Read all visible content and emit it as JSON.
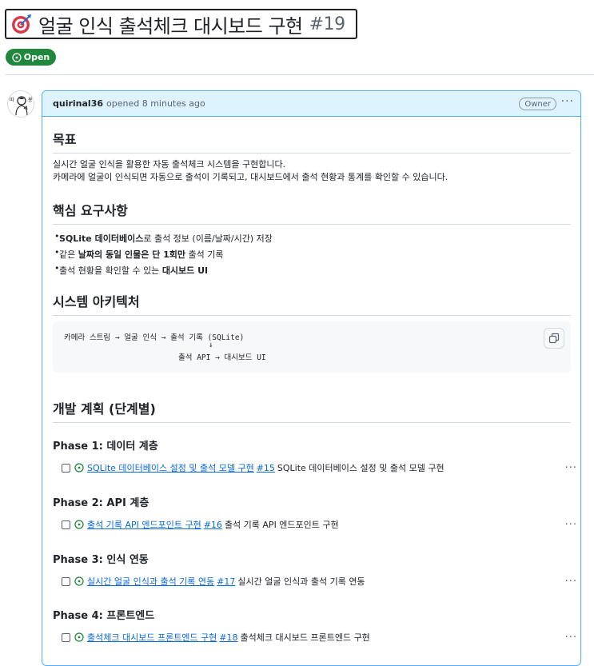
{
  "issue": {
    "title": "얼굴 인식 출석체크 대시보드 구현",
    "number": "#19",
    "status": "Open",
    "title_icon": "dart-target-icon"
  },
  "comment": {
    "author": "quirinal36",
    "meta": "opened 8 minutes ago",
    "role": "Owner",
    "avatar_label": "따봉"
  },
  "sections": {
    "goal": {
      "heading": "목표",
      "line1": "실시간 얼굴 인식을 활용한 자동 출석체크 시스템을 구현합니다.",
      "line2": "카메라에 얼굴이 인식되면 자동으로 출석이 기록되고, 대시보드에서 출석 현황과 통계를 확인할 수 있습니다."
    },
    "requirements": {
      "heading": "핵심 요구사항",
      "items": [
        {
          "bold": "SQLite 데이터베이스",
          "rest": "로 출석 정보 (이름/날짜/시간) 저장"
        },
        {
          "pre": "같은 ",
          "bold": "날짜의 동일 인물은 단 1회만",
          "rest": " 출석 기록"
        },
        {
          "pre": "출석 현황을 확인할 수 있는 ",
          "bold": "대시보드 UI",
          "rest": ""
        }
      ]
    },
    "architecture": {
      "heading": "시스템 아키텍처",
      "code_line1": "카메라 스트림 → 얼굴 인식 → 출석 기록 (SQLite)",
      "code_line2": "↓",
      "code_line3": "출석 API → 대시보드 UI"
    },
    "plan": {
      "heading": "개발 계획 (단계별)",
      "phases": [
        {
          "title": "Phase 1: 데이터 계층",
          "link": "SQLite 데이터베이스 설정 및 출석 모델 구현",
          "num": "#15",
          "desc": "SQLite 데이터베이스 설정 및 출석 모델 구현"
        },
        {
          "title": "Phase 2: API 계층",
          "link": "출석 기록 API 엔드포인트 구현",
          "num": "#16",
          "desc": "출석 기록 API 엔드포인트 구현"
        },
        {
          "title": "Phase 3: 인식 연동",
          "link": "실시간 얼굴 인식과 출석 기록 연동",
          "num": "#17",
          "desc": "실시간 얼굴 인식과 출석 기록 연동"
        },
        {
          "title": "Phase 4: 프론트엔드",
          "link": "출석체크 대시보드 프론트엔드 구현",
          "num": "#18",
          "desc": "출석체크 대시보드 프론트엔드 구현"
        }
      ]
    }
  },
  "colors": {
    "open_green": "#1f883d",
    "link_blue": "#0969da",
    "header_blue": "#ddf4ff",
    "border_blue": "#54aeff"
  }
}
